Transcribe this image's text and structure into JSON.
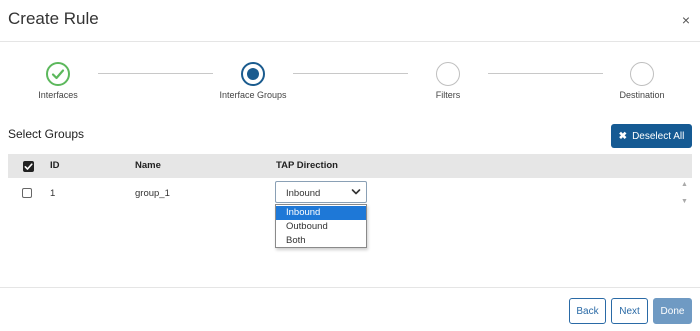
{
  "dialog": {
    "title": "Create Rule",
    "close_glyph": "×"
  },
  "stepper": {
    "steps": [
      {
        "label": "Interfaces",
        "state": "completed"
      },
      {
        "label": "Interface Groups",
        "state": "current"
      },
      {
        "label": "Filters",
        "state": "pending"
      },
      {
        "label": "Destination",
        "state": "pending"
      }
    ]
  },
  "section": {
    "title": "Select Groups",
    "deselect_label": "Deselect All",
    "deselect_icon": "✖"
  },
  "table": {
    "columns": [
      "ID",
      "Name",
      "TAP Direction"
    ],
    "header_checked": true,
    "rows": [
      {
        "checked": false,
        "id": "1",
        "name": "group_1",
        "tap_direction": "Inbound"
      }
    ]
  },
  "dropdown": {
    "options": [
      "Inbound",
      "Outbound",
      "Both"
    ],
    "selected": "Inbound"
  },
  "footer": {
    "back_label": "Back",
    "next_label": "Next",
    "done_label": "Done"
  },
  "colors": {
    "primary": "#155a93",
    "completed": "#5cb85c",
    "selected_option": "#1e78d7"
  }
}
